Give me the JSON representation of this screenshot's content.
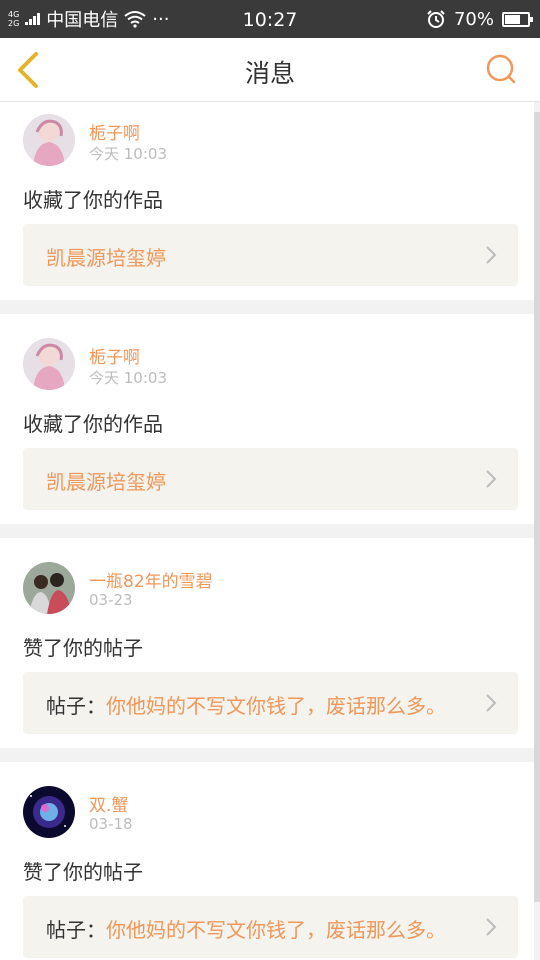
{
  "status_bar": {
    "network_top": "4G",
    "network_bottom": "2G",
    "carrier": "中国电信",
    "more": "···",
    "time": "10:27",
    "battery": "70%",
    "battery_level": 0.7
  },
  "header": {
    "title": "消息",
    "back_icon": "back-chevron-icon",
    "search_icon": "search-icon",
    "accent_color": "#f0975a"
  },
  "messages": [
    {
      "user": "栀子啊",
      "time": "今天 10:03",
      "action": "收藏了你的作品",
      "ref_prefix": "",
      "ref_text": "凯晨源培玺婷"
    },
    {
      "user": "栀子啊",
      "time": "今天 10:03",
      "action": "收藏了你的作品",
      "ref_prefix": "",
      "ref_text": "凯晨源培玺婷"
    },
    {
      "user": "一瓶82年的雪碧",
      "time": "03-23",
      "action": "赞了你的帖子",
      "ref_prefix": "帖子：",
      "ref_text": "你他妈的不写文你钱了，废话那么多。"
    },
    {
      "user": "双.蟹",
      "time": "03-18",
      "action": "赞了你的帖子",
      "ref_prefix": "帖子：",
      "ref_text": "你他妈的不写文你钱了，废话那么多。"
    }
  ]
}
